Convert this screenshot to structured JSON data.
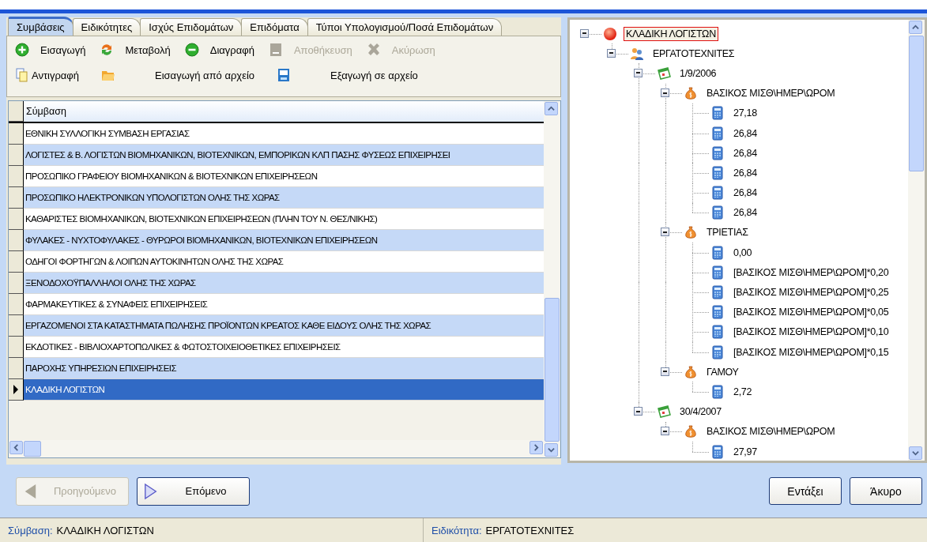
{
  "tabs": [
    {
      "label": "Συμβάσεις",
      "selected": true
    },
    {
      "label": "Ειδικότητες",
      "selected": false
    },
    {
      "label": "Ισχύς Επιδομάτων",
      "selected": false
    },
    {
      "label": "Επιδόματα",
      "selected": false
    },
    {
      "label": "Τύποι Υπολογισμού/Ποσά Επιδομάτων",
      "selected": false
    }
  ],
  "toolbar": [
    [
      {
        "kind": "add",
        "label": "Εισαγωγή",
        "disabled": false
      },
      {
        "kind": "refresh",
        "label": "Μεταβολή",
        "disabled": false
      },
      {
        "kind": "remove",
        "label": "Διαγραφή",
        "disabled": false
      },
      {
        "kind": "save",
        "label": "Αποθήκευση",
        "disabled": true
      },
      {
        "kind": "cancel",
        "label": "Ακύρωση",
        "disabled": true
      }
    ],
    [
      {
        "kind": "copy",
        "label": "Αντιγραφή",
        "disabled": false
      },
      {
        "kind": "import",
        "label": "Εισαγωγή από αρχείο",
        "disabled": false
      },
      {
        "kind": "export",
        "label": "Εξαγωγή σε αρχείο",
        "disabled": false
      }
    ]
  ],
  "table": {
    "column": "Σύμβαση",
    "rows": [
      {
        "text": "ΕΘΝΙΚΗ ΣΥΛΛΟΓΙΚΗ ΣΥΜΒΑΣΗ ΕΡΓΑΣΙΑΣ",
        "selected": false
      },
      {
        "text": "ΛΟΓΙΣΤΕΣ & Β. ΛΟΓΙΣΤΩΝ ΒΙΟΜΗΧΑΝΙΚΩΝ, ΒΙΟΤΕΧΝΙΚΩΝ, ΕΜΠΟΡΙΚΩΝ ΚΛΠ ΠΑΣΗΣ ΦΥΣΕΩΣ ΕΠΙΧΕΙΡΗΣΕΙ",
        "selected": false
      },
      {
        "text": "ΠΡΟΣΩΠΙΚΟ ΓΡΑΦΕΙΟΥ ΒΙΟΜΗΧΑΝΙΚΩΝ & ΒΙΟΤΕΧΝΙΚΩΝ ΕΠΙΧΕΙΡΗΣΕΩΝ",
        "selected": false
      },
      {
        "text": "ΠΡΟΣΩΠΙΚΟ ΗΛΕΚΤΡΟΝΙΚΩΝ ΥΠΟΛΟΓΙΣΤΩΝ ΟΛΗΣ ΤΗΣ ΧΩΡΑΣ",
        "selected": false
      },
      {
        "text": "ΚΑΘΑΡΙΣΤΕΣ ΒΙΟΜΗΧΑΝΙΚΩΝ, ΒΙΟΤΕΧΝΙΚΩΝ ΕΠΙΧΕΙΡΗΣΕΩΝ (ΠΛΗΝ ΤΟΥ Ν. ΘΕΣ/ΝΙΚΗΣ)",
        "selected": false
      },
      {
        "text": "ΦΥΛΑΚΕΣ - ΝΥΧΤΟΦΥΛΑΚΕΣ - ΘΥΡΩΡΟΙ ΒΙΟΜΗΧΑΝΙΚΩΝ, ΒΙΟΤΕΧΝΙΚΩΝ ΕΠΙΧΕΙΡΗΣΕΩΝ",
        "selected": false
      },
      {
        "text": "ΟΔΗΓΟΙ ΦΟΡΤΗΓΩΝ & ΛΟΙΠΩΝ ΑΥΤΟΚΙΝΗΤΩΝ ΟΛΗΣ ΤΗΣ ΧΩΡΑΣ",
        "selected": false
      },
      {
        "text": "ΞΕΝΟΔΟΧΟΫΠΑΛΛΗΛΟΙ ΟΛΗΣ ΤΗΣ ΧΩΡΑΣ",
        "selected": false
      },
      {
        "text": "ΦΑΡΜΑΚΕΥΤΙΚΕΣ & ΣΥΝΑΦΕΙΣ ΕΠΙΧΕΙΡΗΣΕΙΣ",
        "selected": false
      },
      {
        "text": "ΕΡΓΑΖΟΜΕΝΟΙ ΣΤΑ ΚΑΤΑΣΤΗΜΑΤΑ ΠΩΛΗΣΗΣ ΠΡΟΪΟΝΤΩΝ ΚΡΕΑΤΟΣ ΚΑΘΕ ΕΙΔΟΥΣ ΟΛΗΣ ΤΗΣ ΧΩΡΑΣ",
        "selected": false
      },
      {
        "text": "ΕΚΔΟΤΙΚΕΣ - ΒΙΒΛΙΟΧΑΡΤΟΠΩΛΙΚΕΣ & ΦΩΤΟΣΤΟΙΧΕΙΟΘΕΤΙΚΕΣ ΕΠΙΧΕΙΡΗΣΕΙΣ",
        "selected": false
      },
      {
        "text": "ΠΑΡΟΧΗΣ ΥΠΗΡΕΣΙΩΝ ΕΠΙΧΕΙΡΗΣΕΙΣ",
        "selected": false
      },
      {
        "text": "ΚΛΑΔΙΚΗ ΛΟΓΙΣΤΩΝ",
        "selected": true
      }
    ]
  },
  "tree": [
    {
      "kind": "contract",
      "label": "ΚΛΑΔΙΚΗ ΛΟΓΙΣΤΩΝ",
      "selected": true,
      "expanded": true,
      "children": [
        {
          "kind": "specialty",
          "label": "ΕΡΓΑΤΟΤΕΧΝΙΤΕΣ",
          "selected": false,
          "expanded": true,
          "children": [
            {
              "kind": "date",
              "label": "1/9/2006",
              "selected": false,
              "expanded": true,
              "children": [
                {
                  "kind": "allowance",
                  "label": "ΒΑΣΙΚΟΣ ΜΙΣΘ\\ΗΜΕΡ\\ΩΡΟΜ",
                  "selected": false,
                  "expanded": true,
                  "children": [
                    {
                      "kind": "amount",
                      "label": "27,18",
                      "selected": false
                    },
                    {
                      "kind": "amount",
                      "label": "26,84",
                      "selected": false
                    },
                    {
                      "kind": "amount",
                      "label": "26,84",
                      "selected": false
                    },
                    {
                      "kind": "amount",
                      "label": "26,84",
                      "selected": false
                    },
                    {
                      "kind": "amount",
                      "label": "26,84",
                      "selected": false
                    },
                    {
                      "kind": "amount",
                      "label": "26,84",
                      "selected": false
                    }
                  ]
                },
                {
                  "kind": "allowance",
                  "label": "ΤΡΙΕΤΙΑΣ",
                  "selected": false,
                  "expanded": true,
                  "children": [
                    {
                      "kind": "amount",
                      "label": "0,00",
                      "selected": false
                    },
                    {
                      "kind": "amount",
                      "label": "[ΒΑΣΙΚΟΣ ΜΙΣΘ\\ΗΜΕΡ\\ΩΡΟΜ]*0,20",
                      "selected": false
                    },
                    {
                      "kind": "amount",
                      "label": "[ΒΑΣΙΚΟΣ ΜΙΣΘ\\ΗΜΕΡ\\ΩΡΟΜ]*0,25",
                      "selected": false
                    },
                    {
                      "kind": "amount",
                      "label": "[ΒΑΣΙΚΟΣ ΜΙΣΘ\\ΗΜΕΡ\\ΩΡΟΜ]*0,05",
                      "selected": false
                    },
                    {
                      "kind": "amount",
                      "label": "[ΒΑΣΙΚΟΣ ΜΙΣΘ\\ΗΜΕΡ\\ΩΡΟΜ]*0,10",
                      "selected": false
                    },
                    {
                      "kind": "amount",
                      "label": "[ΒΑΣΙΚΟΣ ΜΙΣΘ\\ΗΜΕΡ\\ΩΡΟΜ]*0,15",
                      "selected": false
                    }
                  ]
                },
                {
                  "kind": "allowance",
                  "label": "ΓΑΜΟΥ",
                  "selected": false,
                  "expanded": true,
                  "children": [
                    {
                      "kind": "amount",
                      "label": "2,72",
                      "selected": false
                    }
                  ]
                }
              ]
            },
            {
              "kind": "date",
              "label": "30/4/2007",
              "selected": false,
              "expanded": true,
              "children": [
                {
                  "kind": "allowance",
                  "label": "ΒΑΣΙΚΟΣ ΜΙΣΘ\\ΗΜΕΡ\\ΩΡΟΜ",
                  "selected": false,
                  "expanded": true,
                  "children": [
                    {
                      "kind": "amount",
                      "label": "27,97",
                      "selected": false
                    }
                  ]
                }
              ]
            }
          ]
        }
      ]
    }
  ],
  "nav_buttons": [
    {
      "label": "Προηγούμενο",
      "disabled": true
    },
    {
      "label": "Επόμενο",
      "disabled": false
    }
  ],
  "dialog_buttons": [
    "Εντάξει",
    "Άκυρο"
  ],
  "status_bar": [
    {
      "label": "Σύμβαση:",
      "value": "ΚΛΑΔΙΚΗ ΛΟΓΙΣΤΩΝ"
    },
    {
      "label": "Ειδικότητα:",
      "value": "ΕΡΓΑΤΟΤΕΧΝΙΤΕΣ"
    }
  ]
}
